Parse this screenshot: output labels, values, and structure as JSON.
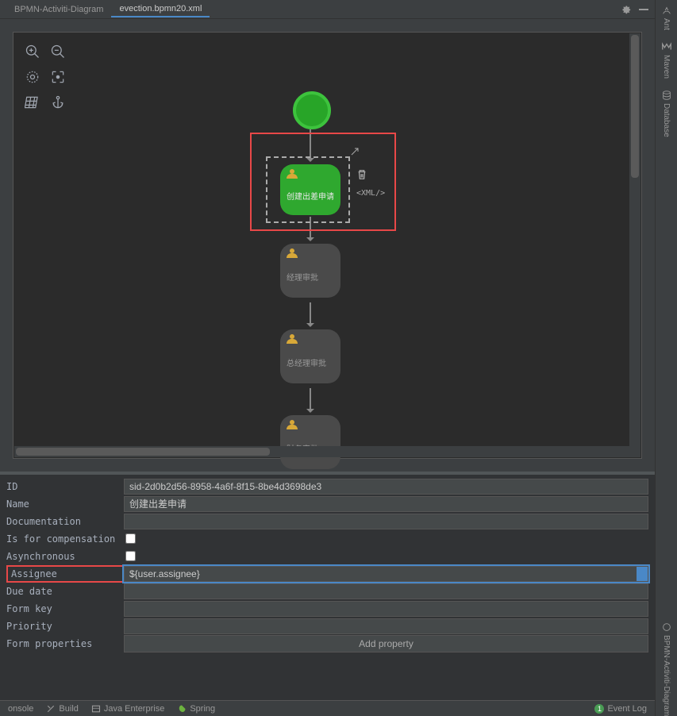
{
  "tabs": [
    {
      "label": "BPMN-Activiti-Diagram",
      "active": false
    },
    {
      "label": "evection.bpmn20.xml",
      "active": true
    }
  ],
  "tasks": {
    "t1": "创建出差申请",
    "t2": "经理审批",
    "t3": "总经理审批",
    "t4": "财务审批"
  },
  "sel_xml": "<XML/>",
  "props": {
    "id_lbl": "ID",
    "id_val": "sid-2d0b2d56-8958-4a6f-8f15-8be4d3698de3",
    "name_lbl": "Name",
    "name_val": "创建出差申请",
    "doc_lbl": "Documentation",
    "doc_val": "",
    "comp_lbl": "Is for compensation",
    "async_lbl": "Asynchronous",
    "assignee_lbl": "Assignee",
    "assignee_val": "${user.assignee}",
    "due_lbl": "Due date",
    "due_val": "",
    "form_lbl": "Form key",
    "form_val": "",
    "prio_lbl": "Priority",
    "prio_val": "",
    "formprop_lbl": "Form properties",
    "add_prop": "Add property"
  },
  "status": {
    "onsole": "onsole",
    "build": "Build",
    "java": "Java Enterprise",
    "spring": "Spring",
    "event": "Event Log",
    "badge": "1"
  },
  "rail": {
    "ant": "Ant",
    "maven": "Maven",
    "db": "Database",
    "bpmn": "BPMN-Activiti-Diagram"
  }
}
